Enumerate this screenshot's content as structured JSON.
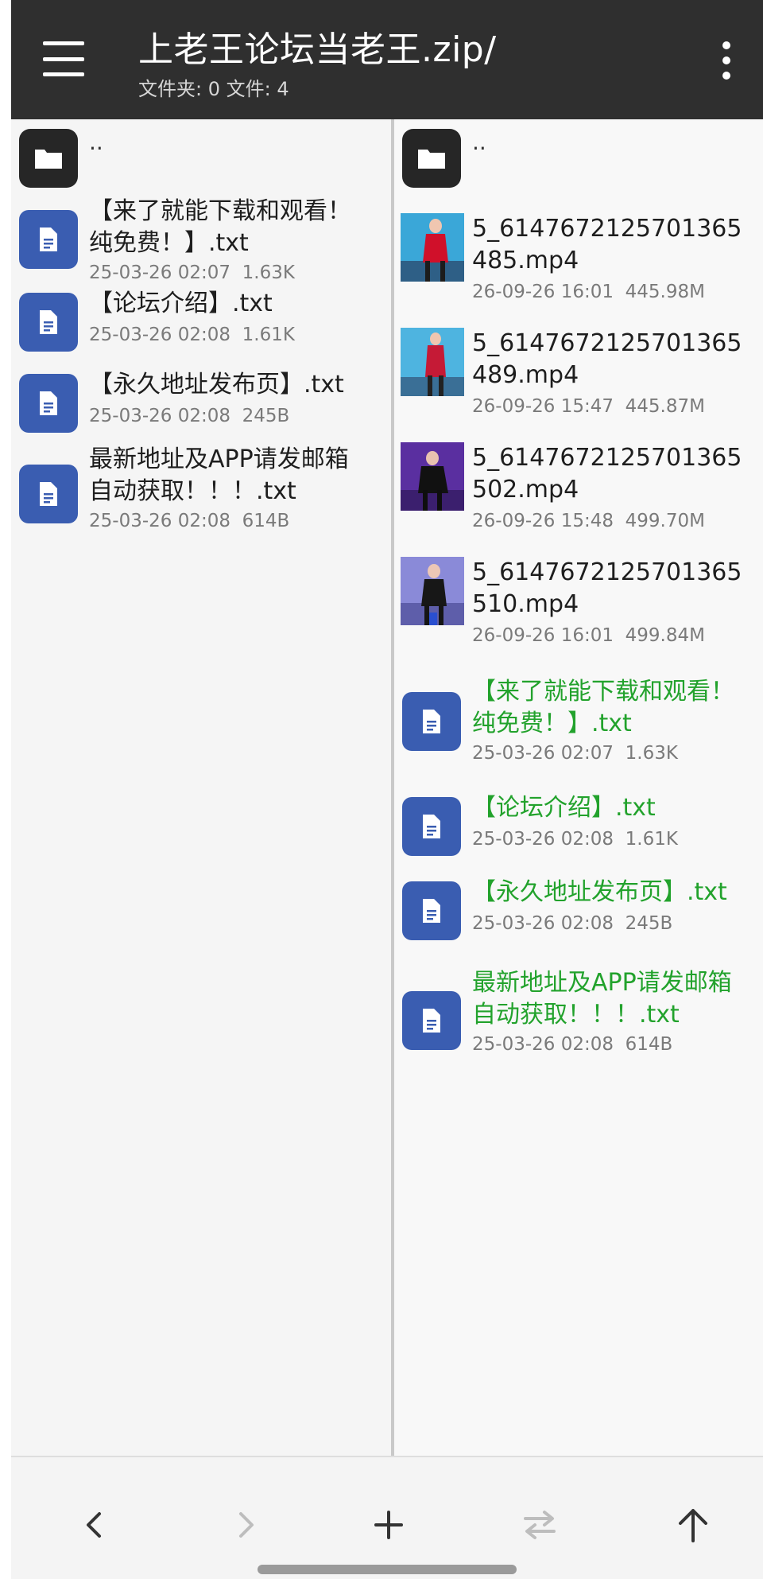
{
  "header": {
    "title": "上老王论坛当老王.zip/",
    "subtitle": "文件夹: 0  文件: 4"
  },
  "left_pane": {
    "parent_label": "..",
    "items": [
      {
        "name_line1": "【来了就能下载和观看！",
        "name_line2": "纯免费！】.txt",
        "date": "25-03-26 02:07",
        "size": "1.63K",
        "icon": "document-icon"
      },
      {
        "name_line1": "【论坛介绍】.txt",
        "name_line2": "",
        "date": "25-03-26 02:08",
        "size": "1.61K",
        "icon": "document-icon"
      },
      {
        "name_line1": "【永久地址发布页】.txt",
        "name_line2": "",
        "date": "25-03-26 02:08",
        "size": "245B",
        "icon": "document-icon"
      },
      {
        "name_line1": "最新地址及APP请发邮箱",
        "name_line2": "自动获取！！！.txt",
        "date": "25-03-26 02:08",
        "size": "614B",
        "icon": "document-icon"
      }
    ]
  },
  "right_pane": {
    "parent_label": "..",
    "videos": [
      {
        "name_line1": "5_6147672125701365",
        "name_line2": "485.mp4",
        "date": "26-09-26 16:01",
        "size": "445.98M"
      },
      {
        "name_line1": "5_6147672125701365",
        "name_line2": "489.mp4",
        "date": "26-09-26 15:47",
        "size": "445.87M"
      },
      {
        "name_line1": "5_6147672125701365",
        "name_line2": "502.mp4",
        "date": "26-09-26 15:48",
        "size": "499.70M"
      },
      {
        "name_line1": "5_6147672125701365",
        "name_line2": "510.mp4",
        "date": "26-09-26 16:01",
        "size": "499.84M"
      }
    ],
    "items": [
      {
        "name_line1": "【来了就能下载和观看！",
        "name_line2": "纯免费！】.txt",
        "date": "25-03-26 02:07",
        "size": "1.63K"
      },
      {
        "name_line1": "【论坛介绍】.txt",
        "name_line2": "",
        "date": "25-03-26 02:08",
        "size": "1.61K"
      },
      {
        "name_line1": "【永久地址发布页】.txt",
        "name_line2": "",
        "date": "25-03-26 02:08",
        "size": "245B"
      },
      {
        "name_line1": "最新地址及APP请发邮箱",
        "name_line2": "自动获取！！！.txt",
        "date": "25-03-26 02:08",
        "size": "614B"
      }
    ]
  },
  "bottom_bar": {
    "buttons": [
      "back-icon",
      "forward-icon",
      "add-icon",
      "swap-icon",
      "up-icon"
    ]
  },
  "colors": {
    "appbar": "#2f2f2f",
    "doc_icon": "#3a5db1",
    "highlight_text": "#22a22c",
    "meta_text": "#7a7a7a"
  }
}
